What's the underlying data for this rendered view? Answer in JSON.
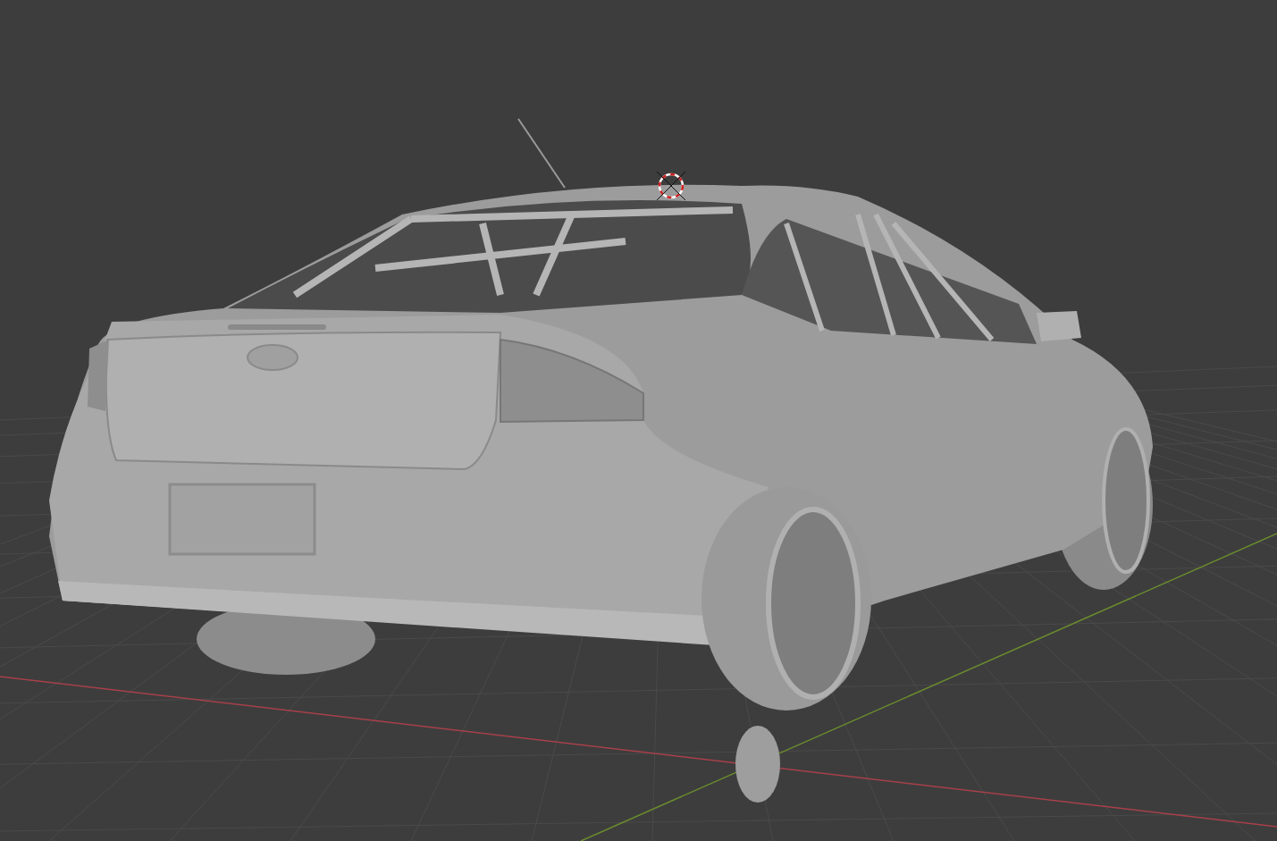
{
  "viewport": {
    "show_grid": true,
    "show_axes": true,
    "show_3d_cursor": true
  }
}
